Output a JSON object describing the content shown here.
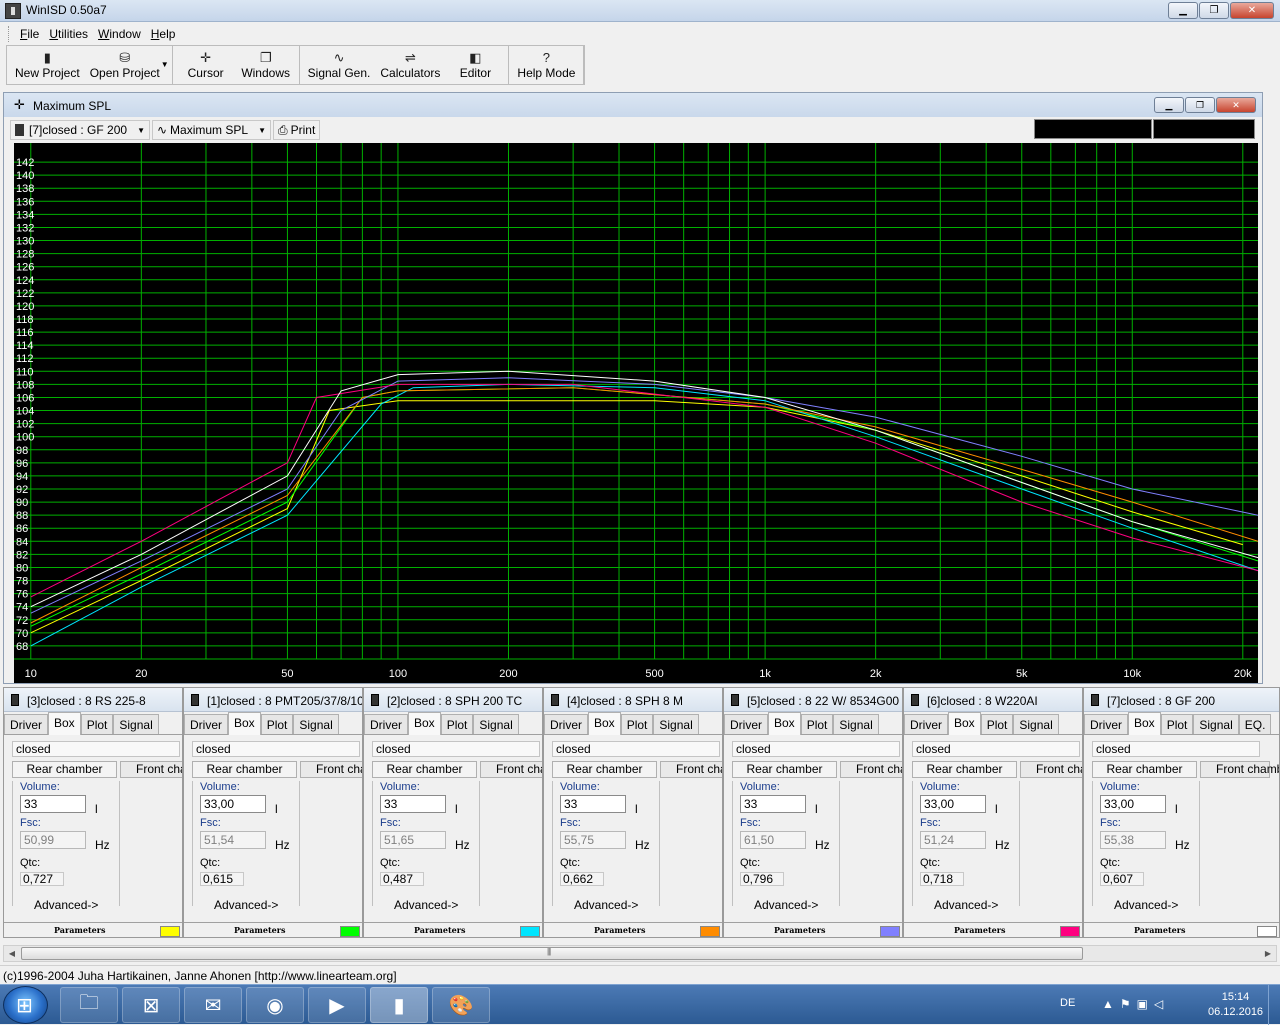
{
  "app": {
    "title": "WinISD 0.50a7"
  },
  "menu": [
    "File",
    "Utilities",
    "Window",
    "Help"
  ],
  "toolbar": [
    {
      "label": "New Project",
      "icon": "new-project-icon",
      "glyph": "▮"
    },
    {
      "label": "Open Project",
      "icon": "open-project-icon",
      "glyph": "⛁"
    },
    {
      "label": "Cursor",
      "icon": "cursor-icon",
      "glyph": "✛"
    },
    {
      "label": "Windows",
      "icon": "windows-icon",
      "glyph": "❐"
    },
    {
      "label": "Signal Gen.",
      "icon": "signal-gen-icon",
      "glyph": "∿"
    },
    {
      "label": "Calculators",
      "icon": "calculators-icon",
      "glyph": "⇌"
    },
    {
      "label": "Editor",
      "icon": "editor-icon",
      "glyph": "◧"
    },
    {
      "label": "Help Mode",
      "icon": "help-mode-icon",
      "glyph": "?"
    }
  ],
  "graph_window": {
    "title": "Maximum SPL",
    "project_select": "[7]closed : GF 200",
    "graph_select": "Maximum SPL",
    "print_label": "Print"
  },
  "chart_data": {
    "type": "line",
    "xscale": "log",
    "xlim": [
      9,
      22000
    ],
    "ylim": [
      66,
      144
    ],
    "x_ticks": [
      {
        "v": 10,
        "label": "10"
      },
      {
        "v": 20,
        "label": "20"
      },
      {
        "v": 50,
        "label": "50"
      },
      {
        "v": 100,
        "label": "100"
      },
      {
        "v": 200,
        "label": "200"
      },
      {
        "v": 500,
        "label": "500"
      },
      {
        "v": 1000,
        "label": "1k"
      },
      {
        "v": 2000,
        "label": "2k"
      },
      {
        "v": 5000,
        "label": "5k"
      },
      {
        "v": 10000,
        "label": "10k"
      },
      {
        "v": 20000,
        "label": "20k"
      }
    ],
    "y_ticks": [
      68,
      70,
      72,
      74,
      76,
      78,
      80,
      82,
      84,
      86,
      88,
      90,
      92,
      94,
      96,
      98,
      100,
      102,
      104,
      106,
      108,
      110,
      112,
      114,
      116,
      118,
      120,
      122,
      124,
      126,
      128,
      130,
      132,
      134,
      136,
      138,
      140,
      142
    ],
    "background": "#000000",
    "grid_color": "#00b000",
    "series": [
      {
        "color": "#ffff00",
        "points": [
          [
            10,
            70
          ],
          [
            20,
            78
          ],
          [
            50,
            89
          ],
          [
            65,
            104
          ],
          [
            100,
            105.5
          ],
          [
            500,
            105.5
          ],
          [
            1000,
            104.5
          ],
          [
            2000,
            101
          ],
          [
            5000,
            94
          ],
          [
            10000,
            88.5
          ],
          [
            20000,
            83.5
          ]
        ]
      },
      {
        "color": "#00ff00",
        "points": [
          [
            10,
            71
          ],
          [
            20,
            79
          ],
          [
            50,
            90
          ],
          [
            80,
            106
          ],
          [
            100,
            107
          ],
          [
            300,
            107.5
          ],
          [
            1000,
            105
          ],
          [
            2000,
            101
          ],
          [
            5000,
            93
          ],
          [
            10000,
            87
          ],
          [
            22000,
            81
          ]
        ]
      },
      {
        "color": "#00e5ff",
        "points": [
          [
            10,
            68
          ],
          [
            20,
            77
          ],
          [
            50,
            88
          ],
          [
            90,
            105
          ],
          [
            110,
            107.5
          ],
          [
            200,
            108
          ],
          [
            500,
            107.5
          ],
          [
            1000,
            105.5
          ],
          [
            2000,
            100
          ],
          [
            5000,
            92
          ],
          [
            10000,
            86
          ],
          [
            22000,
            79.5
          ]
        ]
      },
      {
        "color": "#ff8c00",
        "points": [
          [
            10,
            71.5
          ],
          [
            20,
            80
          ],
          [
            50,
            91
          ],
          [
            80,
            106
          ],
          [
            100,
            107
          ],
          [
            300,
            107.5
          ],
          [
            1000,
            105
          ],
          [
            2000,
            101.5
          ],
          [
            5000,
            95
          ],
          [
            10000,
            90
          ],
          [
            22000,
            84
          ]
        ]
      },
      {
        "color": "#8080ff",
        "points": [
          [
            10,
            73
          ],
          [
            20,
            81
          ],
          [
            50,
            92
          ],
          [
            70,
            104
          ],
          [
            100,
            108.5
          ],
          [
            200,
            109
          ],
          [
            500,
            108
          ],
          [
            1000,
            106
          ],
          [
            2000,
            103
          ],
          [
            5000,
            97
          ],
          [
            10000,
            92
          ],
          [
            22000,
            88
          ]
        ]
      },
      {
        "color": "#ff0080",
        "points": [
          [
            10,
            75.5
          ],
          [
            20,
            84
          ],
          [
            50,
            96
          ],
          [
            60,
            106
          ],
          [
            100,
            108
          ],
          [
            300,
            108
          ],
          [
            1000,
            104.5
          ],
          [
            2000,
            99
          ],
          [
            5000,
            90
          ],
          [
            10000,
            84.5
          ],
          [
            22000,
            79.5
          ]
        ]
      },
      {
        "color": "#ffffff",
        "points": [
          [
            10,
            74
          ],
          [
            20,
            82
          ],
          [
            50,
            94
          ],
          [
            70,
            107
          ],
          [
            100,
            109.5
          ],
          [
            200,
            110
          ],
          [
            500,
            108.5
          ],
          [
            1000,
            106
          ],
          [
            2000,
            101
          ],
          [
            5000,
            93
          ],
          [
            10000,
            87
          ],
          [
            22000,
            81.5
          ]
        ]
      }
    ]
  },
  "panels": [
    {
      "title": "[3]closed : 8 RS 225-8",
      "volume": "33",
      "fsc": "50,99",
      "qtc": "0,727",
      "color": "#ffff00"
    },
    {
      "title": "[1]closed : 8 PMT205/37/8/100",
      "volume": "33,00",
      "fsc": "51,54",
      "qtc": "0,615",
      "color": "#00ff00"
    },
    {
      "title": "[2]closed : 8 SPH 200 TC",
      "volume": "33",
      "fsc": "51,65",
      "qtc": "0,487",
      "color": "#00e5ff"
    },
    {
      "title": "[4]closed : 8 SPH 8 M",
      "volume": "33",
      "fsc": "55,75",
      "qtc": "0,662",
      "color": "#ff8c00"
    },
    {
      "title": "[5]closed : 8 22 W/ 8534G00",
      "volume": "33",
      "fsc": "61,50",
      "qtc": "0,796",
      "color": "#8080ff"
    },
    {
      "title": "[6]closed : 8 W220AI",
      "volume": "33,00",
      "fsc": "51,24",
      "qtc": "0,718",
      "color": "#ff0080"
    },
    {
      "title": "[7]closed : 8 GF 200",
      "volume": "33,00",
      "fsc": "55,38",
      "qtc": "0,607",
      "color": "#ffffff"
    }
  ],
  "panel_labels": {
    "tabs": [
      "Driver",
      "Box",
      "Plot",
      "Signal"
    ],
    "extra_tab": "EQ.",
    "box_type": "closed",
    "rear_chamber": "Rear chamber",
    "front_chamber": "Front cha",
    "front_chamber_last": "Front chamb",
    "volume": "Volume:",
    "volume_unit": "l",
    "fsc": "Fsc:",
    "fsc_unit": "Hz",
    "qtc": "Qtc:",
    "advanced": "Advanced->",
    "parameters": "Parameters"
  },
  "status": "(c)1996-2004 Juha Hartikainen, Janne Ahonen [http://www.linearteam.org]",
  "taskbar": {
    "apps": [
      "explorer-icon",
      "network-icon",
      "thunderbird-icon",
      "firefox-icon",
      "media-player-icon",
      "winisd-icon",
      "paint-icon"
    ],
    "lang": "DE",
    "time": "15:14",
    "date": "06.12.2016"
  }
}
